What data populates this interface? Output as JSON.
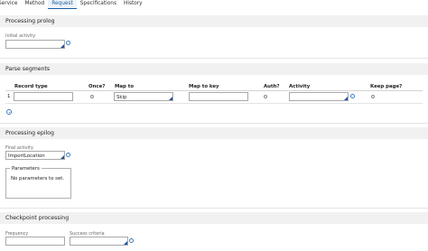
{
  "tabs": [
    "Service",
    "Method",
    "Request",
    "Specifications",
    "History"
  ],
  "active_tab": "Request",
  "prolog": {
    "title": "Processing prolog",
    "initial_activity_label": "Initial activity",
    "initial_activity_value": ""
  },
  "parse": {
    "title": "Parse segments",
    "columns": [
      "Record type",
      "Once?",
      "Map to",
      "Map to key",
      "Auth?",
      "Activity",
      "Keep page?"
    ],
    "rows": [
      {
        "index": "1",
        "record_type": "",
        "map_to": "Skip",
        "map_to_key": "",
        "activity": ""
      }
    ]
  },
  "epilog": {
    "title": "Processing epilog",
    "final_activity_label": "Final activity",
    "final_activity_value": "ImportLocation",
    "parameters_legend": "Parameters",
    "parameters_text": "No parameters to set."
  },
  "checkpoint": {
    "title": "Checkpoint processing",
    "frequency_label": "Frequency",
    "frequency_value": "",
    "success_label": "Success criteria",
    "success_value": ""
  }
}
